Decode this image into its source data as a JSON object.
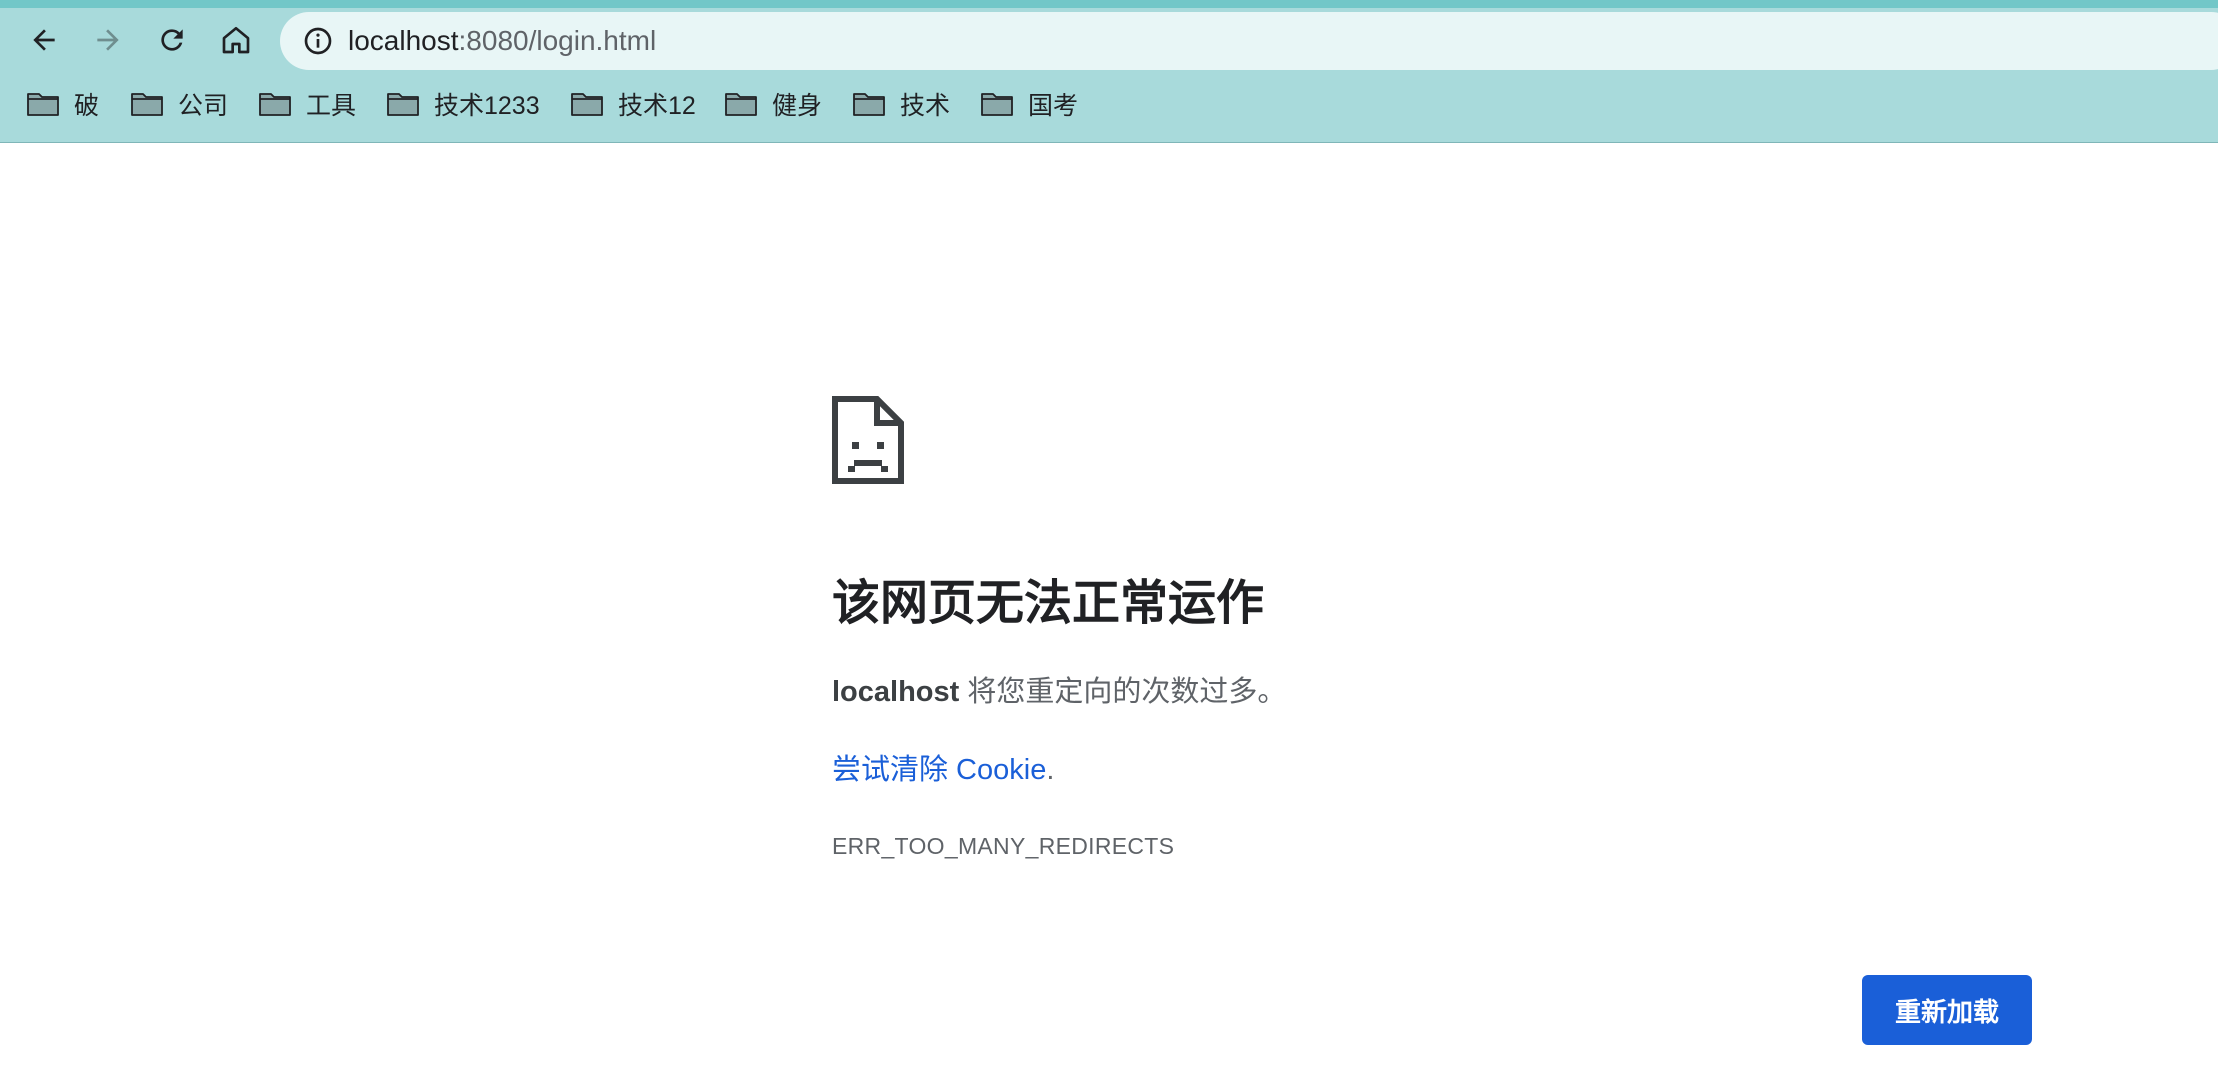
{
  "browser": {
    "url_host": "localhost",
    "url_rest": ":8080/login.html",
    "bookmarks": [
      {
        "label": "破"
      },
      {
        "label": "公司"
      },
      {
        "label": "工具"
      },
      {
        "label": "技术1233"
      },
      {
        "label": "技术12"
      },
      {
        "label": "健身"
      },
      {
        "label": "技术"
      },
      {
        "label": "国考"
      }
    ]
  },
  "error_page": {
    "title": "该网页无法正常运作",
    "host": "localhost",
    "description": " 将您重定向的次数过多。",
    "link_text": "尝试清除 Cookie",
    "link_suffix": ".",
    "error_code": "ERR_TOO_MANY_REDIRECTS",
    "reload_label": "重新加载"
  },
  "colors": {
    "chrome_background": "#a8dadb",
    "accent_blue": "#1a5fd8"
  }
}
